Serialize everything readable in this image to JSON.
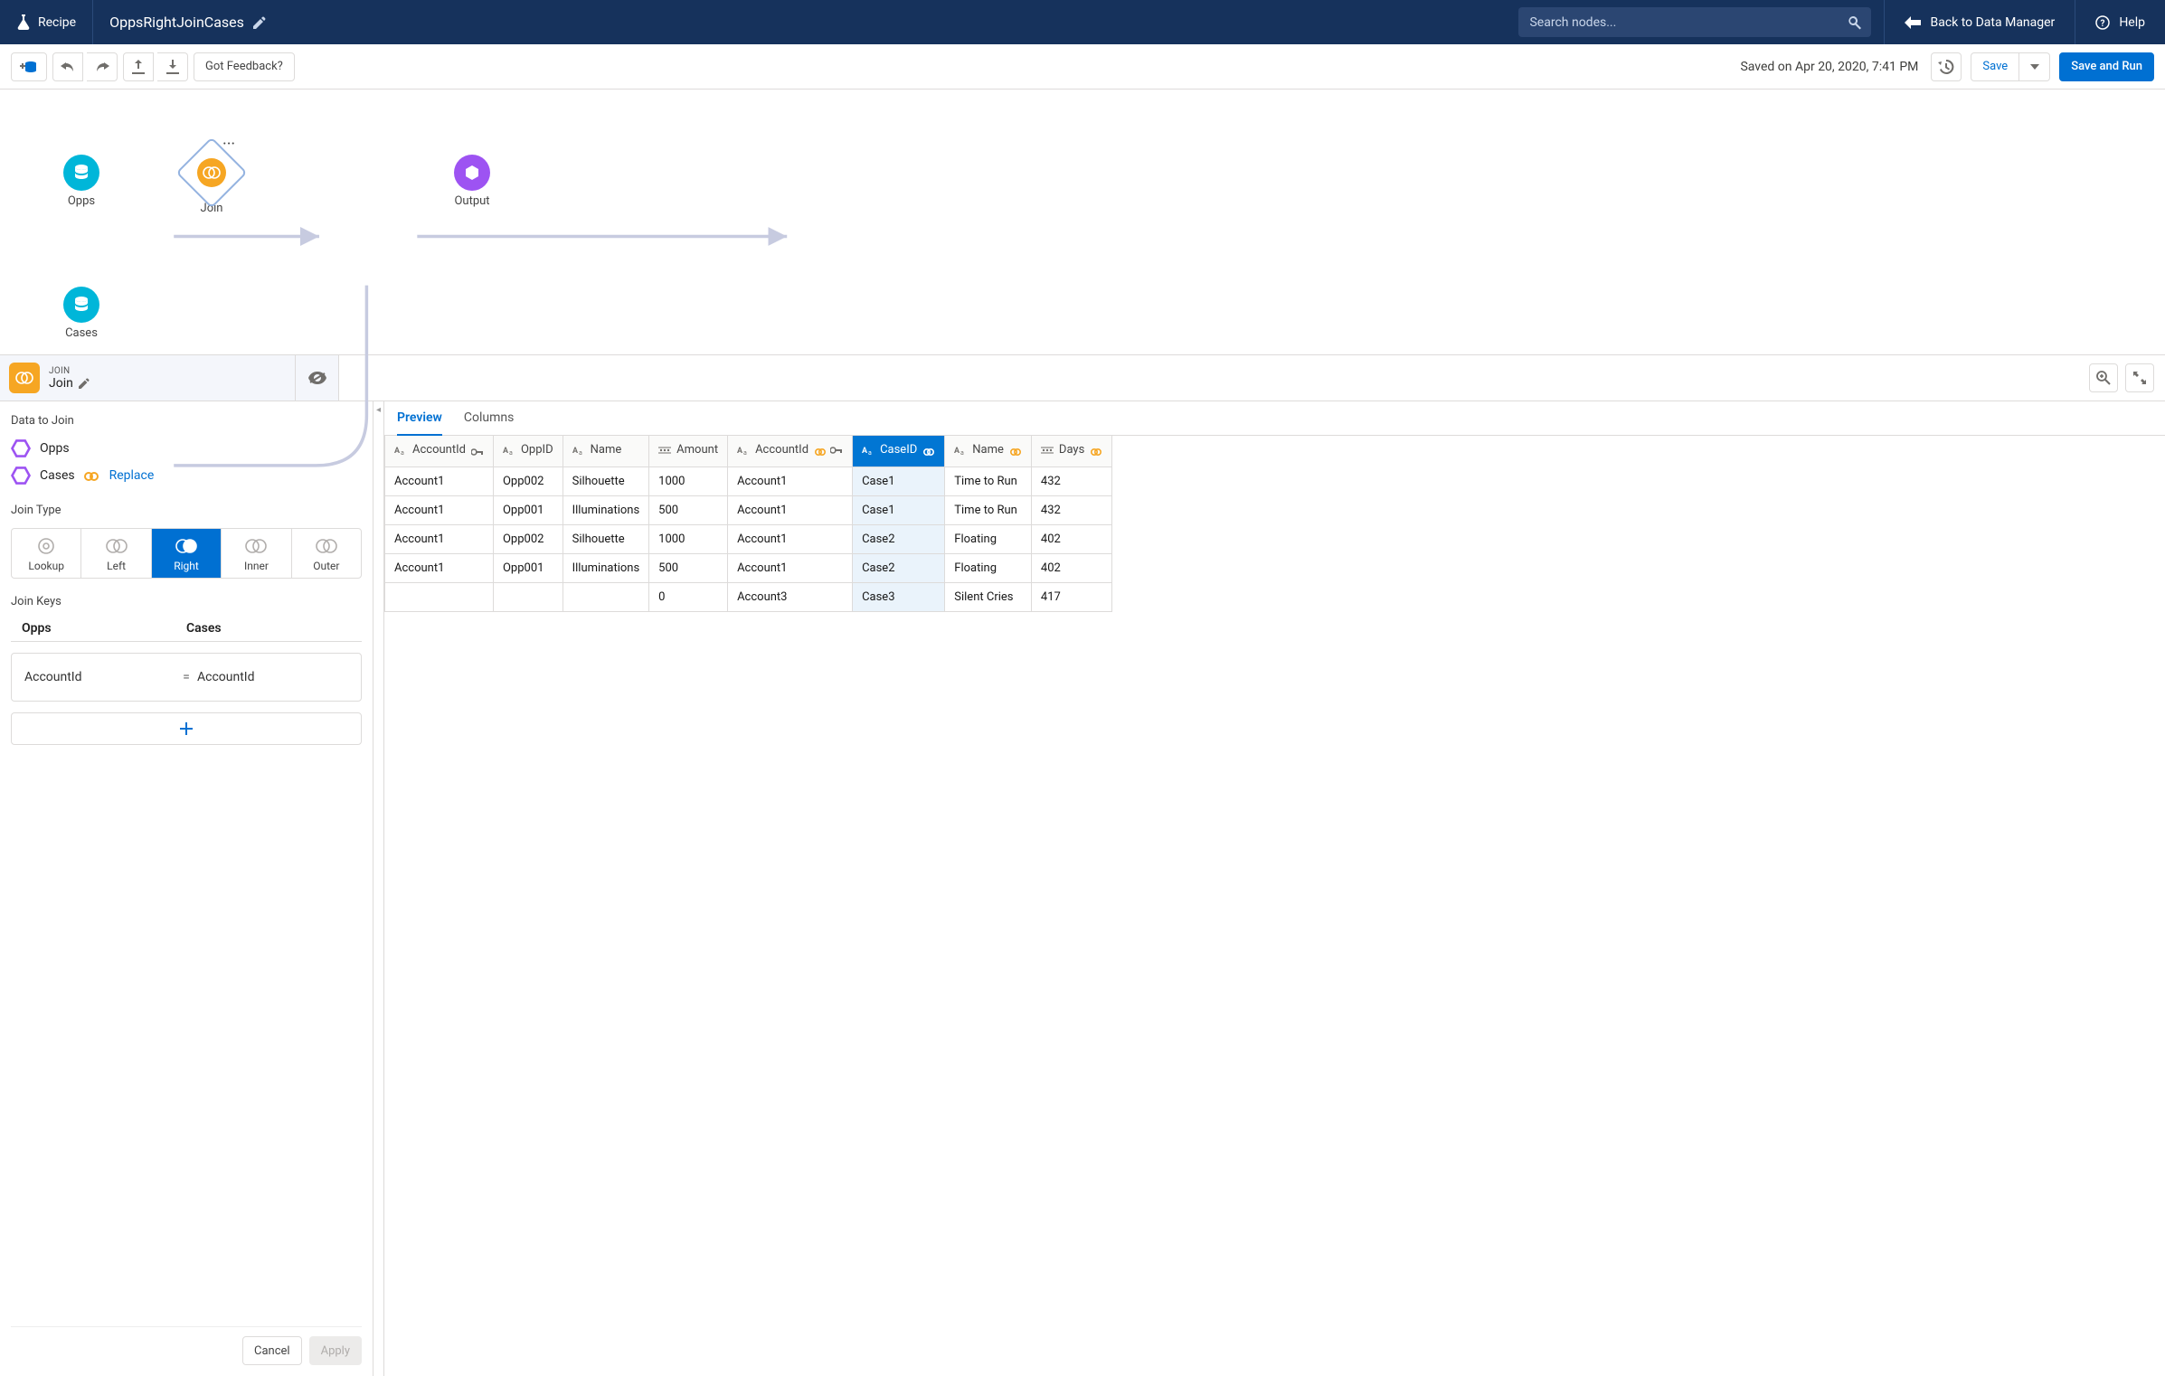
{
  "header": {
    "brand": "Recipe",
    "title": "OppsRightJoinCases",
    "search_placeholder": "Search nodes...",
    "back": "Back to Data Manager",
    "help": "Help"
  },
  "toolbar": {
    "feedback": "Got Feedback?",
    "saved_text": "Saved on Apr 20, 2020, 7:41 PM",
    "save": "Save",
    "save_run": "Save and Run"
  },
  "canvas": {
    "nodes": {
      "opps": "Opps",
      "cases": "Cases",
      "join": "Join",
      "output": "Output"
    }
  },
  "panel": {
    "sup": "JOIN",
    "name": "Join"
  },
  "sidebar": {
    "data_to_join": "Data to Join",
    "ds1": "Opps",
    "ds2": "Cases",
    "replace": "Replace",
    "join_type": "Join Type",
    "types": {
      "lookup": "Lookup",
      "left": "Left",
      "right": "Right",
      "inner": "Inner",
      "outer": "Outer"
    },
    "join_keys": "Join Keys",
    "keys_head_left": "Opps",
    "keys_head_right": "Cases",
    "key_left": "AccountId",
    "key_eq": "=",
    "key_right": "AccountId",
    "cancel": "Cancel",
    "apply": "Apply"
  },
  "preview": {
    "tabs": {
      "preview": "Preview",
      "columns": "Columns"
    },
    "cols": [
      {
        "label": "AccountId",
        "type": "text",
        "key": true
      },
      {
        "label": "OppID",
        "type": "text"
      },
      {
        "label": "Name",
        "type": "text"
      },
      {
        "label": "Amount",
        "type": "number"
      },
      {
        "label": "AccountId",
        "type": "text",
        "link": true,
        "key": true
      },
      {
        "label": "CaseID",
        "type": "text",
        "link": true,
        "selected": true
      },
      {
        "label": "Name",
        "type": "text",
        "link": true
      },
      {
        "label": "Days",
        "type": "number",
        "link": true
      }
    ],
    "rows": [
      [
        "Account1",
        "Opp002",
        "Silhouette",
        "1000",
        "Account1",
        "Case1",
        "Time to Run",
        "432"
      ],
      [
        "Account1",
        "Opp001",
        "Illuminations",
        "500",
        "Account1",
        "Case1",
        "Time to Run",
        "432"
      ],
      [
        "Account1",
        "Opp002",
        "Silhouette",
        "1000",
        "Account1",
        "Case2",
        "Floating",
        "402"
      ],
      [
        "Account1",
        "Opp001",
        "Illuminations",
        "500",
        "Account1",
        "Case2",
        "Floating",
        "402"
      ],
      [
        "",
        "",
        "",
        "0",
        "Account3",
        "Case3",
        "Silent Cries",
        "417"
      ]
    ]
  }
}
